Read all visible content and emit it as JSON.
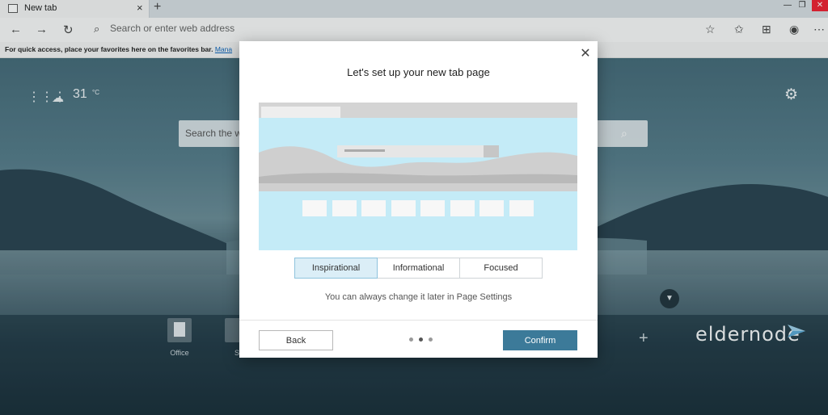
{
  "browser": {
    "tab_title": "New tab",
    "tab_close": "×",
    "new_tab": "+",
    "address_placeholder": "Search or enter web address",
    "favorites_bar_text": "For quick access, place your favorites here on the favorites bar.",
    "favorites_bar_link": "Mana"
  },
  "ntp": {
    "weather_temp": "31",
    "weather_unit": "°C",
    "search_placeholder": "Search the w",
    "quicklinks": [
      {
        "label": "Office"
      },
      {
        "label": "S"
      }
    ],
    "add_quicklink": "+",
    "watermark": "eldernode"
  },
  "modal": {
    "title": "Let's set up your new tab page",
    "close": "✕",
    "layouts": [
      {
        "label": "Inspirational",
        "selected": true
      },
      {
        "label": "Informational",
        "selected": false
      },
      {
        "label": "Focused",
        "selected": false
      }
    ],
    "hint": "You can always change it later in Page Settings",
    "back_label": "Back",
    "confirm_label": "Confirm",
    "step_current": 2,
    "step_total": 3
  },
  "colors": {
    "confirm": "#3c7a99",
    "preview_sky": "#c4ebf7",
    "selected_segment": "#dbeef7"
  }
}
